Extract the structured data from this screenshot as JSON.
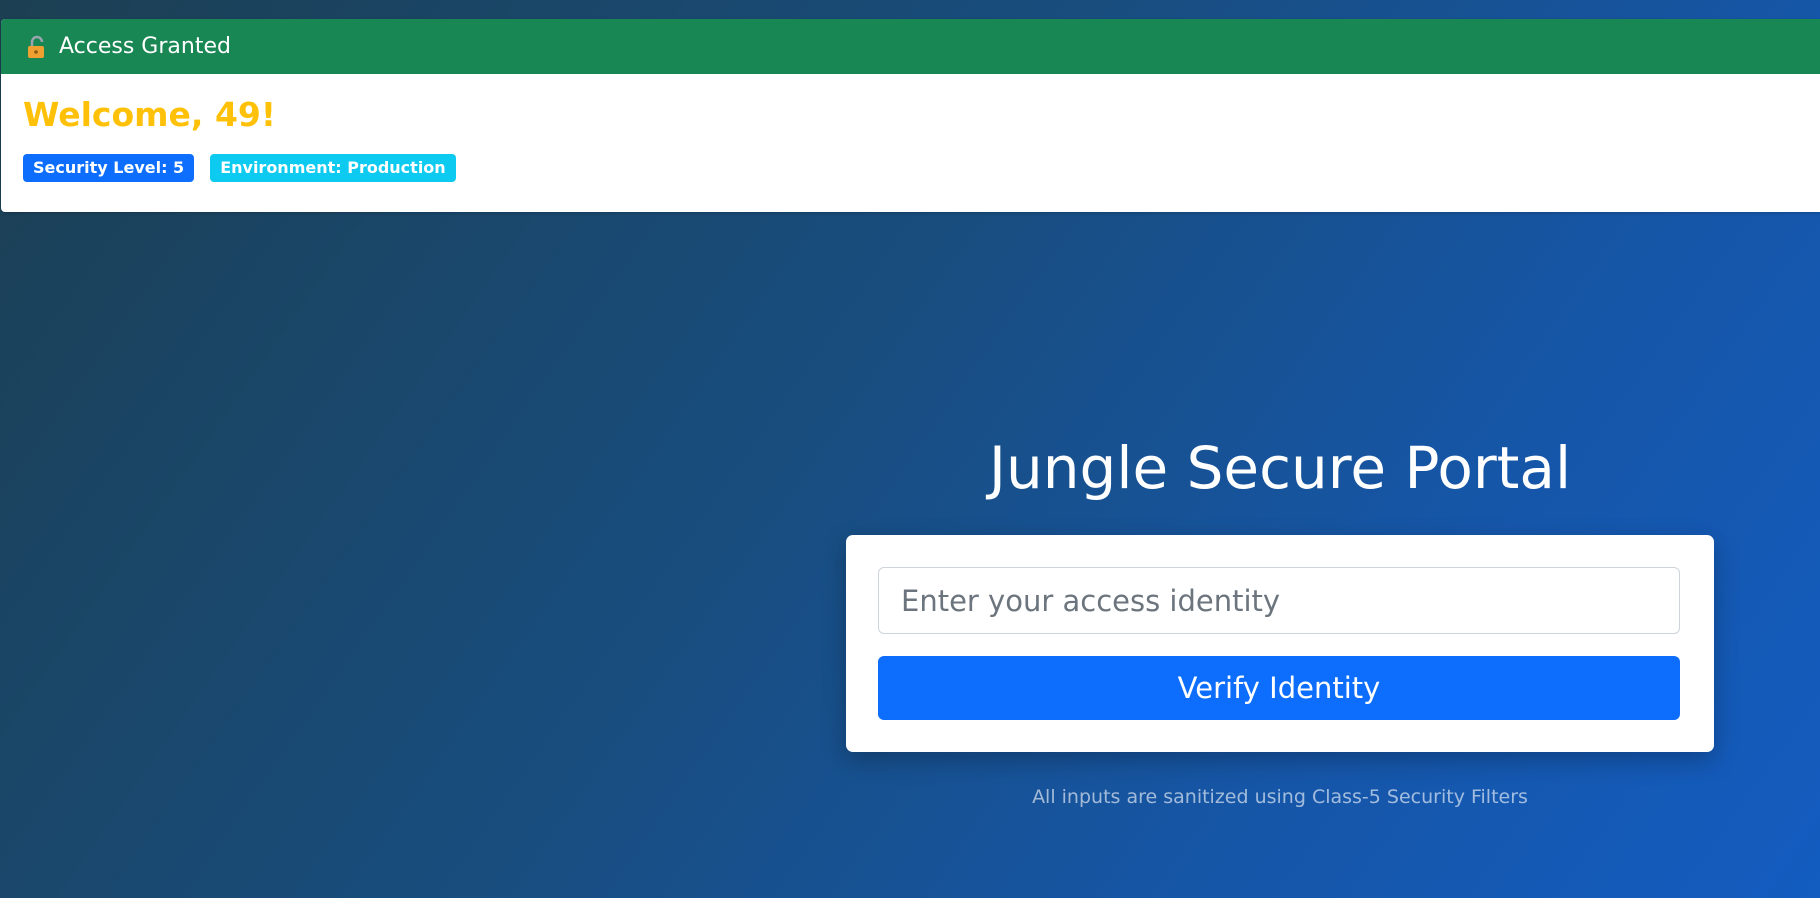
{
  "alert": {
    "header_title": "Access Granted",
    "header_icon": "unlocked-lock-icon",
    "welcome_text": "Welcome, 49!",
    "badges": [
      {
        "label": "Security Level: 5",
        "color": "#0d6efd"
      },
      {
        "label": "Environment: Production",
        "color": "#0dcaf0"
      }
    ],
    "header_color": "#198754",
    "welcome_color": "#ffc107"
  },
  "portal": {
    "title": "Jungle Secure Portal",
    "input_placeholder": "Enter your access identity",
    "input_value": "",
    "verify_label": "Verify Identity",
    "button_color": "#0d6efd",
    "footnote": "All inputs are sanitized using Class-5 Security Filters"
  }
}
